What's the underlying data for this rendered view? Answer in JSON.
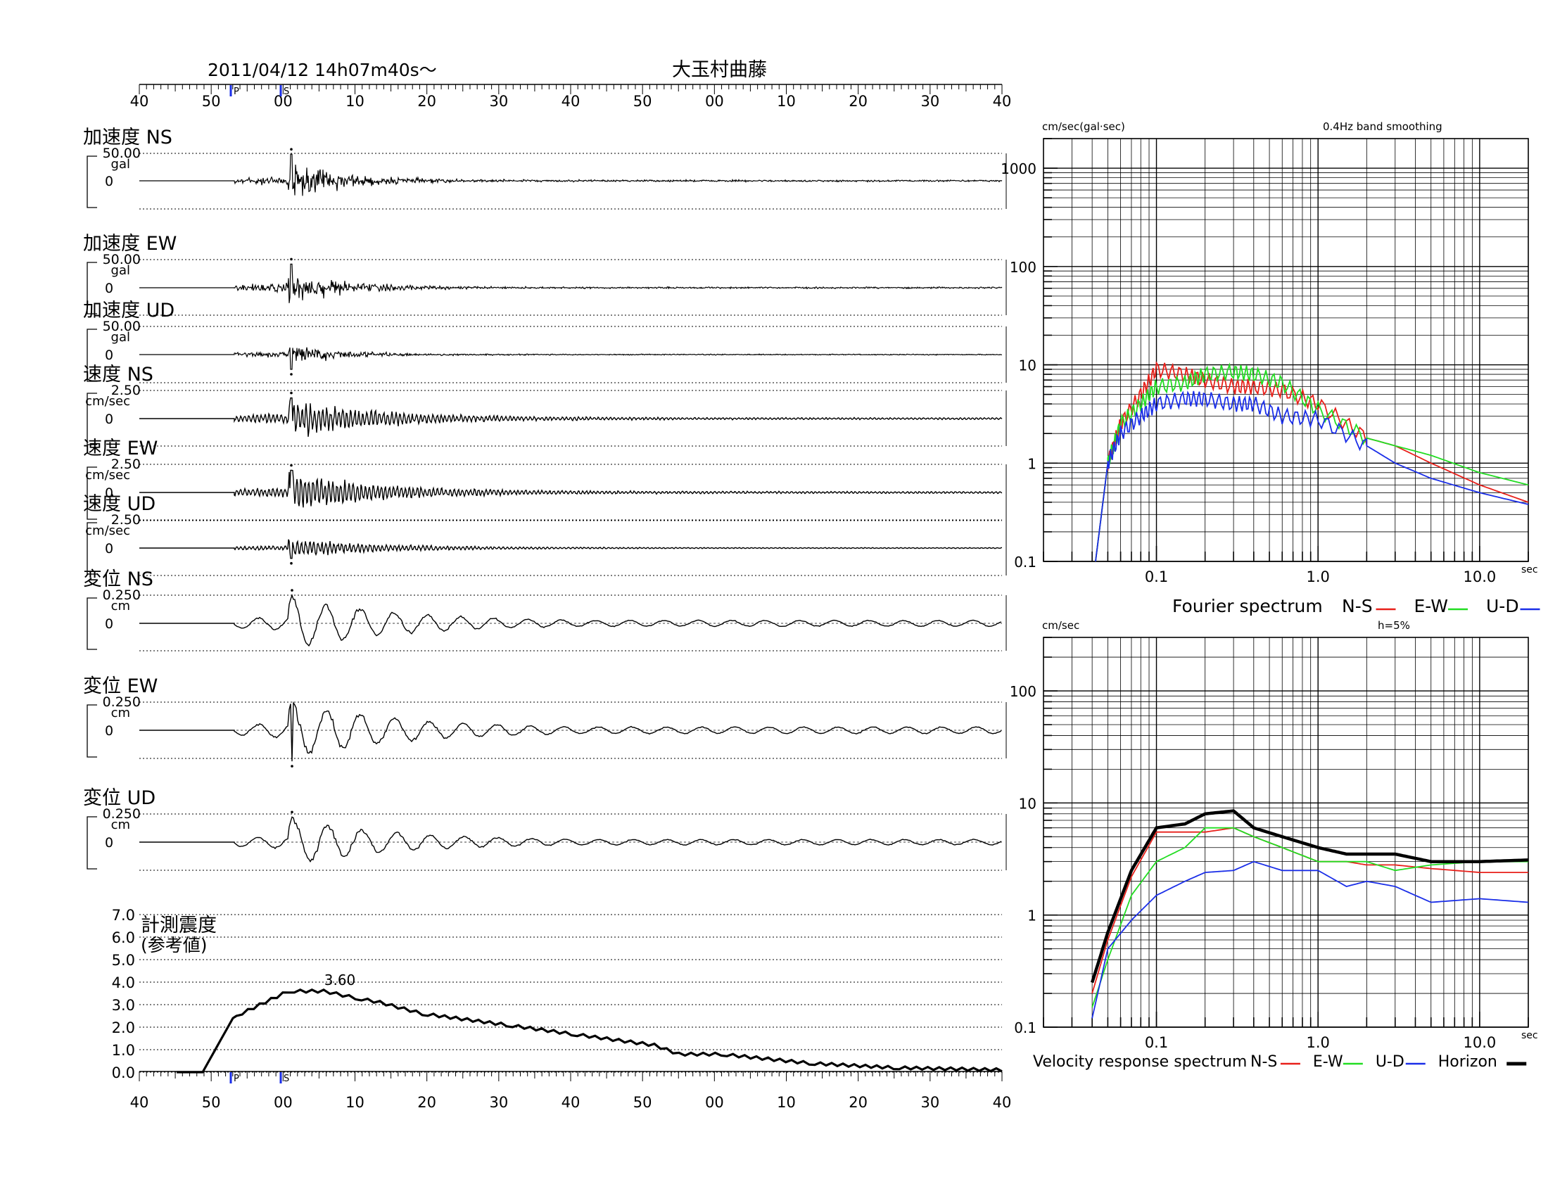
{
  "header": {
    "datetime": "2011/04/12  14h07m40s～",
    "station": "大玉村曲藤"
  },
  "time_axis": {
    "tick_labels": [
      "40",
      "50",
      "00",
      "10",
      "20",
      "30",
      "40",
      "50",
      "00",
      "10",
      "20",
      "30",
      "40"
    ],
    "p_marker": "P",
    "s_marker": "S"
  },
  "traces": [
    {
      "title": "加速度 NS",
      "max": "50.00",
      "unit": "gal",
      "zero": "0"
    },
    {
      "title": "加速度 EW",
      "max": "50.00",
      "unit": "gal",
      "zero": "0"
    },
    {
      "title": "加速度 UD",
      "max": "50.00",
      "unit": "gal",
      "zero": "0"
    },
    {
      "title": "速度 NS",
      "max": "2.50",
      "unit": "cm/sec",
      "zero": "0"
    },
    {
      "title": "速度 EW",
      "max": "2.50",
      "unit": "cm/sec",
      "zero": "0"
    },
    {
      "title": "速度 UD",
      "max": "2.50",
      "unit": "cm/sec",
      "zero": "0"
    },
    {
      "title": "変位 NS",
      "max": "0.250",
      "unit": "cm",
      "zero": "0"
    },
    {
      "title": "変位 EW",
      "max": "0.250",
      "unit": "cm",
      "zero": "0"
    },
    {
      "title": "変位 UD",
      "max": "0.250",
      "unit": "cm",
      "zero": "0"
    }
  ],
  "intensity": {
    "title_line1": "計測震度",
    "title_line2": "(参考値)",
    "y_ticks": [
      "7.0",
      "6.0",
      "5.0",
      "4.0",
      "3.0",
      "2.0",
      "1.0",
      "0.0"
    ],
    "peak_label": "3.60"
  },
  "fourier": {
    "unit_label": "cm/sec(gal·sec)",
    "note": "0.4Hz band smoothing",
    "y_ticks": [
      "1000",
      "100",
      "10",
      "1",
      "0.1"
    ],
    "x_ticks": [
      "0.1",
      "1.0",
      "10.0"
    ],
    "x_unit": "sec",
    "legend_title": "Fourier spectrum",
    "legend": [
      {
        "label": "N-S",
        "color": "#e8201a"
      },
      {
        "label": "E-W",
        "color": "#22dd22"
      },
      {
        "label": "U-D",
        "color": "#1a2ee8"
      }
    ]
  },
  "response": {
    "unit_label": "cm/sec",
    "note": "h=5%",
    "y_ticks": [
      "100",
      "10",
      "1",
      "0.1"
    ],
    "x_ticks": [
      "0.1",
      "1.0",
      "10.0"
    ],
    "x_unit": "sec",
    "legend_title": "Velocity response spectrum",
    "legend": [
      {
        "label": "N-S",
        "color": "#e8201a"
      },
      {
        "label": "E-W",
        "color": "#22dd22"
      },
      {
        "label": "U-D",
        "color": "#1a2ee8"
      },
      {
        "label": "Horizon",
        "color": "#000000"
      }
    ]
  },
  "chart_data": [
    {
      "type": "line",
      "title": "計測震度 (参考値)",
      "ylim": [
        0,
        7
      ],
      "x": [
        "50",
        "55",
        "58",
        "00",
        "01",
        "06",
        "10",
        "15",
        "20",
        "30",
        "40",
        "50",
        "55",
        "00",
        "13",
        "20",
        "40"
      ],
      "values": [
        0.0,
        0.0,
        2.4,
        2.5,
        3.6,
        3.6,
        3.3,
        3.1,
        2.6,
        2.1,
        1.7,
        1.2,
        0.8,
        0.8,
        0.4,
        0.2,
        0.1
      ],
      "peak": 3.6
    },
    {
      "type": "line",
      "title": "Fourier spectrum",
      "x_scale": "log",
      "xlim": [
        0.02,
        20
      ],
      "y_scale": "log",
      "ylim": [
        0.1,
        2000
      ],
      "x": [
        0.042,
        0.05,
        0.06,
        0.08,
        0.1,
        0.15,
        0.2,
        0.3,
        0.4,
        0.6,
        1.0,
        2.0,
        3.0,
        5.0,
        10.0,
        20.0
      ],
      "series": [
        {
          "name": "N-S",
          "values": [
            0.1,
            1.0,
            2.5,
            5.0,
            9.0,
            8.0,
            7.0,
            6.0,
            6.0,
            5.5,
            4.0,
            1.8,
            1.5,
            1.0,
            0.6,
            0.4
          ]
        },
        {
          "name": "E-W",
          "values": [
            0.1,
            1.0,
            2.5,
            4.0,
            6.0,
            6.5,
            8.0,
            8.5,
            8.0,
            6.5,
            3.5,
            1.8,
            1.5,
            1.2,
            0.8,
            0.6
          ]
        },
        {
          "name": "U-D",
          "values": [
            0.1,
            1.0,
            2.0,
            3.0,
            4.0,
            4.5,
            4.5,
            4.0,
            4.0,
            3.0,
            2.8,
            1.5,
            1.0,
            0.7,
            0.5,
            0.38
          ]
        }
      ]
    },
    {
      "type": "line",
      "title": "Velocity response spectrum",
      "x_scale": "log",
      "xlim": [
        0.02,
        20
      ],
      "y_scale": "log",
      "ylim": [
        0.1,
        300
      ],
      "x": [
        0.04,
        0.05,
        0.07,
        0.1,
        0.15,
        0.2,
        0.3,
        0.4,
        0.6,
        1.0,
        1.5,
        2.0,
        3.0,
        5.0,
        10.0,
        20.0
      ],
      "series": [
        {
          "name": "N-S",
          "values": [
            0.2,
            0.6,
            2.2,
            5.5,
            5.5,
            5.5,
            6.0,
            5.0,
            4.0,
            3.0,
            3.0,
            2.8,
            2.8,
            2.6,
            2.4,
            2.4
          ]
        },
        {
          "name": "E-W",
          "values": [
            0.15,
            0.4,
            1.5,
            3.0,
            4.0,
            6.0,
            6.0,
            5.0,
            4.0,
            3.0,
            3.0,
            3.0,
            2.5,
            2.8,
            3.0,
            3.0
          ]
        },
        {
          "name": "U-D",
          "values": [
            0.12,
            0.5,
            0.9,
            1.5,
            2.0,
            2.4,
            2.5,
            3.0,
            2.5,
            2.5,
            1.8,
            2.0,
            1.8,
            1.3,
            1.4,
            1.3
          ]
        },
        {
          "name": "Horizon",
          "values": [
            0.25,
            0.7,
            2.5,
            6.0,
            6.5,
            8.0,
            8.5,
            6.0,
            5.0,
            4.0,
            3.5,
            3.5,
            3.5,
            3.0,
            3.0,
            3.1
          ]
        }
      ]
    }
  ]
}
